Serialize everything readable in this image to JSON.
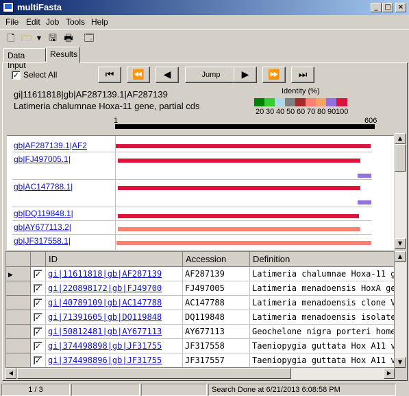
{
  "window": {
    "title": "multiFasta"
  },
  "menu": [
    "File",
    "Edit",
    "Job",
    "Tools",
    "Help"
  ],
  "toolbar": {
    "icons": [
      "new-file-icon",
      "open-folder-icon",
      "dropdown-arrow-icon",
      "save-icon",
      "print-icon",
      "window-icon"
    ]
  },
  "tabs": [
    {
      "label": "Data Input",
      "active": false
    },
    {
      "label": "Results",
      "active": true
    }
  ],
  "results": {
    "select_all_label": "Select All",
    "select_all_checked": true,
    "jump_label": "Jump",
    "sequence_id": "gi|11611818|gb|AF287139.1|AF287139",
    "sequence_desc": "Latimeria chalumnae Hoxa-11 gene, partial cds",
    "identity_label": "Identity (%)",
    "identity_scale": [
      {
        "label": "20",
        "color": "#008000"
      },
      {
        "label": "30",
        "color": "#33cc33"
      },
      {
        "label": "40",
        "color": "#add8e6"
      },
      {
        "label": "50",
        "color": "#808080"
      },
      {
        "label": "60",
        "color": "#a52a2a"
      },
      {
        "label": "70",
        "color": "#fa8072"
      },
      {
        "label": "80",
        "color": "#f4a460"
      },
      {
        "label": "90",
        "color": "#9370db"
      },
      {
        "label": "100",
        "color": "#dc143c"
      }
    ],
    "ruler": {
      "start": "1",
      "end": "606"
    },
    "hits": [
      {
        "label": "gb|AF287139.1|AF2",
        "color": "#dc143c"
      },
      {
        "label": "gb|FJ497005.1|",
        "color": "#dc143c"
      },
      {
        "label": "gb|AC147788.1|",
        "color": "#dc143c"
      },
      {
        "label": "gb|DQ119848.1|",
        "color": "#dc143c"
      },
      {
        "label": "gb|AY677113.2|",
        "color": "#fa8072"
      },
      {
        "label": "gb|JF317558.1|",
        "color": "#fa8072"
      }
    ]
  },
  "grid": {
    "columns": [
      "ID",
      "Accession",
      "Definition"
    ],
    "rows": [
      {
        "current": true,
        "checked": true,
        "id": "gi|11611818|gb|AF287139",
        "accession": "AF287139",
        "definition": "Latimeria chalumnae Hoxa-11 g"
      },
      {
        "current": false,
        "checked": true,
        "id": "gi|220898172|gb|FJ49700",
        "accession": "FJ497005",
        "definition": "Latimeria menadoensis HoxA ge"
      },
      {
        "current": false,
        "checked": true,
        "id": "gi|40789109|gb|AC147788",
        "accession": "AC147788",
        "definition": "Latimeria menadoensis clone V"
      },
      {
        "current": false,
        "checked": true,
        "id": "gi|71391605|gb|DQ119848",
        "accession": "DQ119848",
        "definition": "Latimeria menadoensis isolate I"
      },
      {
        "current": false,
        "checked": true,
        "id": "gi|50812481|gb|AY677113",
        "accession": "AY677113",
        "definition": "Geochelone nigra porteri homeo"
      },
      {
        "current": false,
        "checked": true,
        "id": "gi|374498898|gb|JF31755",
        "accession": "JF317558",
        "definition": "Taeniopygia guttata Hox A11 va"
      },
      {
        "current": false,
        "checked": true,
        "id": "gi|374498896|gb|JF31755",
        "accession": "JF317557",
        "definition": "Taeniopygia guttata Hox A11 va"
      }
    ]
  },
  "status": {
    "page": "1 / 3",
    "message": "Search Done at  6/21/2013 6:08:58 PM"
  }
}
